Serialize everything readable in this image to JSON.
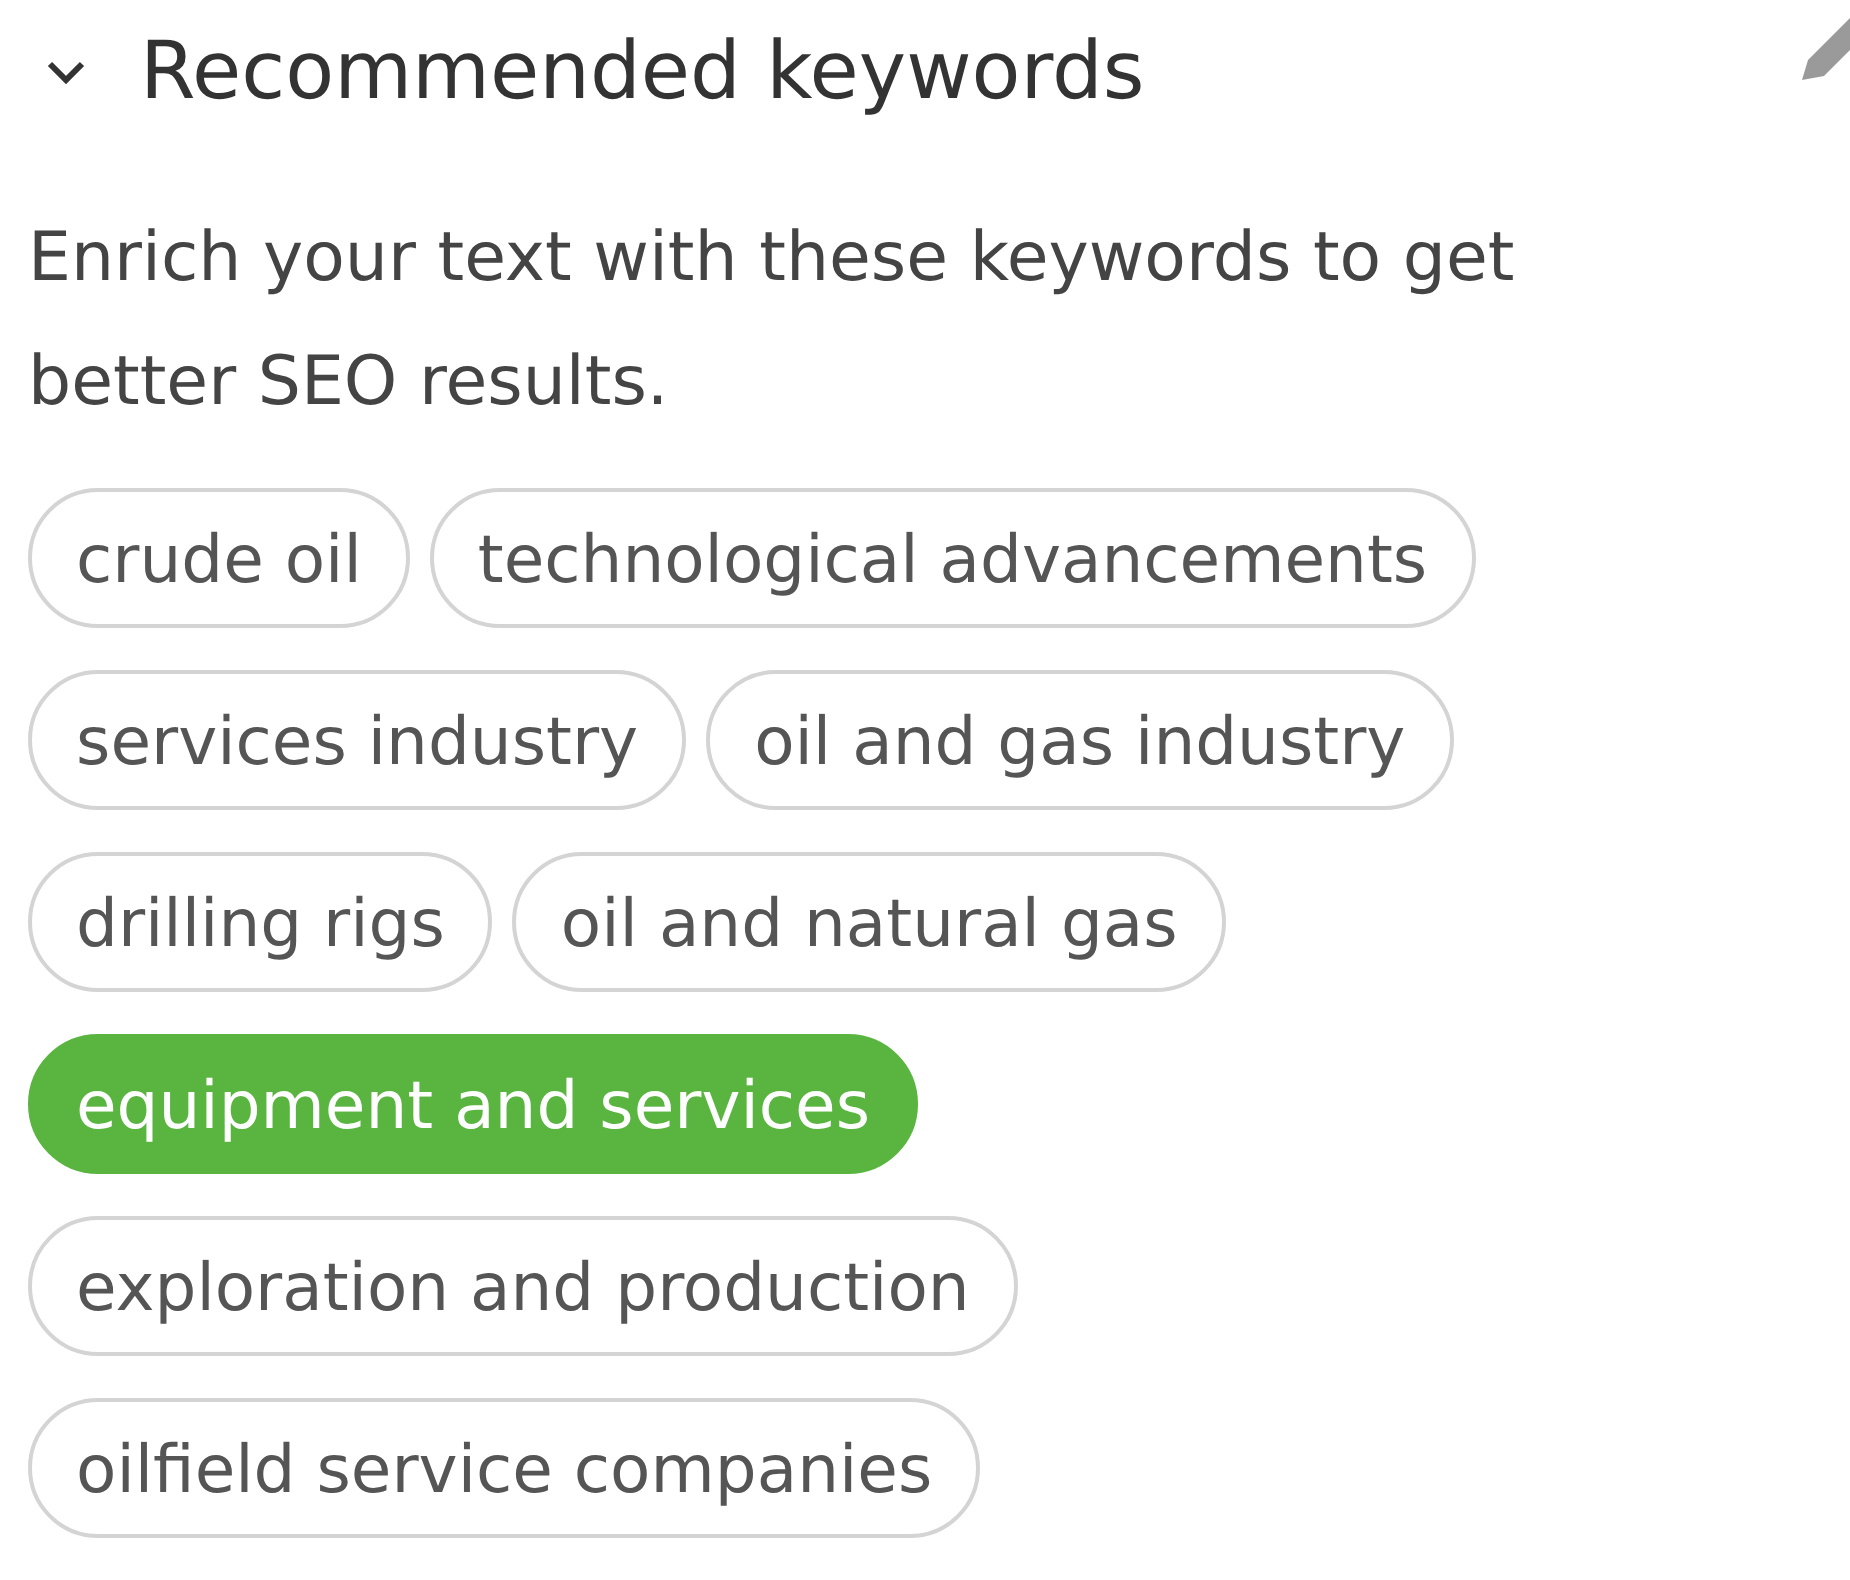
{
  "section": {
    "title": "Recommended keywords",
    "expanded": true
  },
  "description": "Enrich your text with these keywords to get better SEO results.",
  "keywords": [
    {
      "label": "crude oil",
      "selected": false
    },
    {
      "label": "technological advancements",
      "selected": false
    },
    {
      "label": "services industry",
      "selected": false
    },
    {
      "label": "oil and gas industry",
      "selected": false
    },
    {
      "label": "drilling rigs",
      "selected": false
    },
    {
      "label": "oil and natural gas",
      "selected": false
    },
    {
      "label": "equipment and services",
      "selected": true
    },
    {
      "label": "exploration and production",
      "selected": false
    },
    {
      "label": "oilfield service companies",
      "selected": false
    }
  ]
}
